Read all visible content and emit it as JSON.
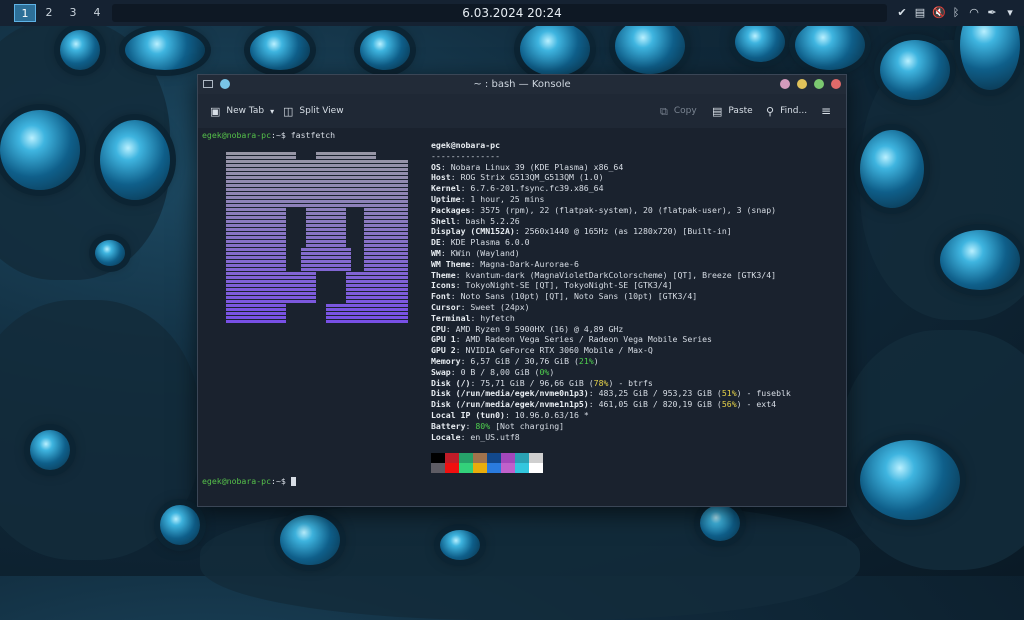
{
  "panel": {
    "desktops": [
      "1",
      "2",
      "3",
      "4"
    ],
    "active_desktop": "1",
    "clock": "6.03.2024 20:24",
    "tray_icons": [
      "checkmark-icon",
      "clipboard-icon",
      "mute-icon",
      "bluetooth-icon",
      "wifi-icon",
      "feather-icon",
      "chevron-down-icon"
    ]
  },
  "window": {
    "title": "~ : bash — Konsole",
    "toolbar": {
      "new_tab": "New Tab",
      "split_view": "Split View",
      "copy": "Copy",
      "paste": "Paste",
      "find": "Find...",
      "menu_icon": "hamburger-icon"
    }
  },
  "terminal": {
    "prompt1_user": "egek@nobara-pc",
    "prompt1_rest": ":~$ fastfetch",
    "prompt2_user": "egek@nobara-pc",
    "prompt2_rest": ":~$ ",
    "header": "egek@nobara-pc",
    "separator": "--------------",
    "info": [
      {
        "k": "OS",
        "v": ": Nobara Linux 39 (KDE Plasma) x86_64"
      },
      {
        "k": "Host",
        "v": ": ROG Strix G513QM_G513QM (1.0)"
      },
      {
        "k": "Kernel",
        "v": ": 6.7.6-201.fsync.fc39.x86_64"
      },
      {
        "k": "Uptime",
        "v": ": 1 hour, 25 mins"
      },
      {
        "k": "Packages",
        "v": ": 3575 (rpm), 22 (flatpak-system), 20 (flatpak-user), 3 (snap)"
      },
      {
        "k": "Shell",
        "v": ": bash 5.2.26"
      },
      {
        "k": "Display (CMN152A)",
        "v": ": 2560x1440 @ 165Hz (as 1280x720) [Built-in]"
      },
      {
        "k": "DE",
        "v": ": KDE Plasma 6.0.0"
      },
      {
        "k": "WM",
        "v": ": KWin (Wayland)"
      },
      {
        "k": "WM Theme",
        "v": ": Magna-Dark-Aurorae-6"
      },
      {
        "k": "Theme",
        "v": ": kvantum-dark (MagnaVioletDarkColorscheme) [QT], Breeze [GTK3/4]"
      },
      {
        "k": "Icons",
        "v": ": TokyoNight-SE [QT], TokyoNight-SE [GTK3/4]"
      },
      {
        "k": "Font",
        "v": ": Noto Sans (10pt) [QT], Noto Sans (10pt) [GTK3/4]"
      },
      {
        "k": "Cursor",
        "v": ": Sweet (24px)"
      },
      {
        "k": "Terminal",
        "v": ": hyfetch"
      },
      {
        "k": "CPU",
        "v": ": AMD Ryzen 9 5900HX (16) @ 4,89 GHz"
      },
      {
        "k": "GPU 1",
        "v": ": AMD Radeon Vega Series / Radeon Vega Mobile Series"
      },
      {
        "k": "GPU 2",
        "v": ": NVIDIA GeForce RTX 3060 Mobile / Max-Q"
      },
      {
        "k": "Memory",
        "v": ": 6,57 GiB / 30,76 GiB (",
        "pct": "21%",
        "pcol": "g",
        "tail": ")"
      },
      {
        "k": "Swap",
        "v": ": 0 B / 8,00 GiB (",
        "pct": "0%",
        "pcol": "g",
        "tail": ")"
      },
      {
        "k": "Disk (/)",
        "v": ": 75,71 GiB / 96,66 GiB (",
        "pct": "78%",
        "pcol": "y",
        "tail": ") - btrfs"
      },
      {
        "k": "Disk (/run/media/egek/nvme0n1p3)",
        "v": ": 483,25 GiB / 953,23 GiB (",
        "pct": "51%",
        "pcol": "y",
        "tail": ") - fuseblk"
      },
      {
        "k": "Disk (/run/media/egek/nvme1n1p5)",
        "v": ": 461,05 GiB / 820,19 GiB (",
        "pct": "56%",
        "pcol": "y",
        "tail": ") - ext4"
      },
      {
        "k": "Local IP (tun0)",
        "v": ": 10.96.0.63/16 *"
      },
      {
        "k": "Battery",
        "v": ": ",
        "pct": "80%",
        "pcol": "g",
        "tail": " [Not charging]"
      },
      {
        "k": "Locale",
        "v": ": en_US.utf8"
      }
    ],
    "palette_top": [
      "#000000",
      "#c01c28",
      "#26a269",
      "#a2734c",
      "#12488b",
      "#a347ba",
      "#2aa1b3",
      "#cfcfcf"
    ],
    "palette_bottom": [
      "#5e5c64",
      "#f00f0f",
      "#33d17a",
      "#e9ad0c",
      "#2a7bde",
      "#c061cb",
      "#33c7de",
      "#ffffff"
    ]
  }
}
